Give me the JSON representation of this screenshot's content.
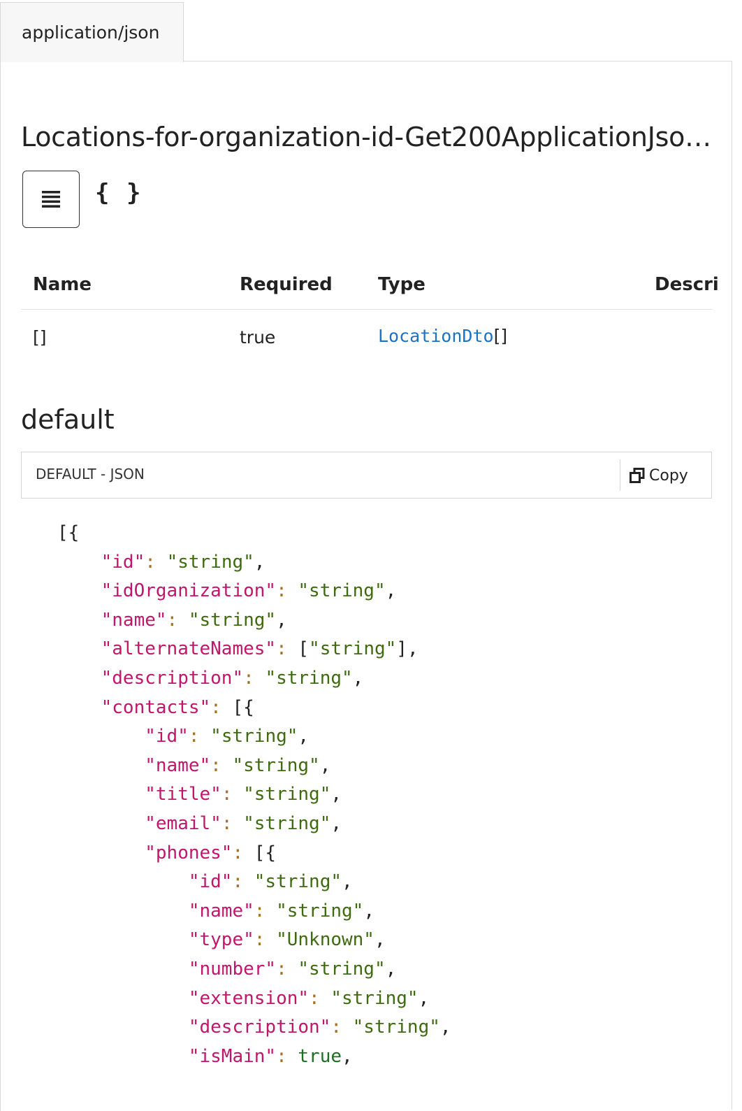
{
  "tab": {
    "label": "application/json"
  },
  "schema": {
    "title": "Locations-for-organization-id-Get200ApplicationJso…",
    "json_toggle": "{ }"
  },
  "table": {
    "headers": [
      "Name",
      "Required",
      "Type",
      "Descri"
    ],
    "rows": [
      {
        "name": "[]",
        "required": "true",
        "type_link": "LocationDto",
        "type_suffix": "[]"
      }
    ]
  },
  "example": {
    "title": "default",
    "header_label": "DEFAULT - JSON",
    "copy_label": "Copy",
    "opening": "[{",
    "lines": [
      {
        "indent": 1,
        "key": "\"id\"",
        "value": "\"string\"",
        "trail": ","
      },
      {
        "indent": 1,
        "key": "\"idOrganization\"",
        "value": "\"string\"",
        "trail": ","
      },
      {
        "indent": 1,
        "key": "\"name\"",
        "value": "\"string\"",
        "trail": ","
      },
      {
        "indent": 1,
        "key": "\"alternateNames\"",
        "value": "[\"string\"]",
        "trail": ","
      },
      {
        "indent": 1,
        "key": "\"description\"",
        "value": "\"string\"",
        "trail": ","
      },
      {
        "indent": 1,
        "key": "\"contacts\"",
        "value": "[{",
        "trail": ""
      },
      {
        "indent": 2,
        "key": "\"id\"",
        "value": "\"string\"",
        "trail": ","
      },
      {
        "indent": 2,
        "key": "\"name\"",
        "value": "\"string\"",
        "trail": ","
      },
      {
        "indent": 2,
        "key": "\"title\"",
        "value": "\"string\"",
        "trail": ","
      },
      {
        "indent": 2,
        "key": "\"email\"",
        "value": "\"string\"",
        "trail": ","
      },
      {
        "indent": 2,
        "key": "\"phones\"",
        "value": "[{",
        "trail": ""
      },
      {
        "indent": 3,
        "key": "\"id\"",
        "value": "\"string\"",
        "trail": ","
      },
      {
        "indent": 3,
        "key": "\"name\"",
        "value": "\"string\"",
        "trail": ","
      },
      {
        "indent": 3,
        "key": "\"type\"",
        "value": "\"Unknown\"",
        "trail": ","
      },
      {
        "indent": 3,
        "key": "\"number\"",
        "value": "\"string\"",
        "trail": ","
      },
      {
        "indent": 3,
        "key": "\"extension\"",
        "value": "\"string\"",
        "trail": ","
      },
      {
        "indent": 3,
        "key": "\"description\"",
        "value": "\"string\"",
        "trail": ","
      },
      {
        "indent": 3,
        "key": "\"isMain\"",
        "value": "true",
        "trail": ","
      }
    ]
  }
}
